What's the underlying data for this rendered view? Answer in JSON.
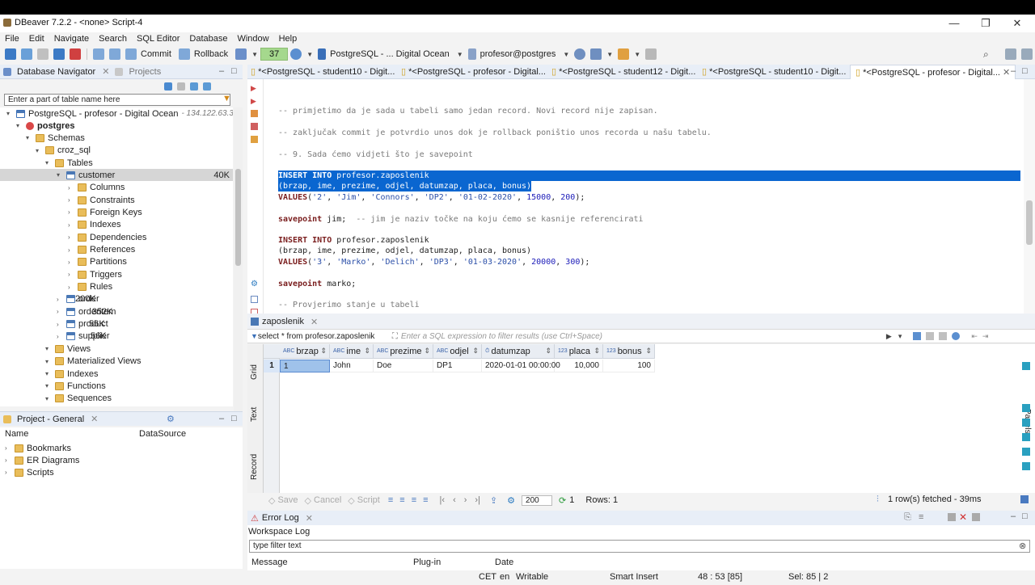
{
  "window": {
    "title": "DBeaver 7.2.2 - <none> Script-4",
    "minimize": "—",
    "restore": "❐",
    "close": "✕"
  },
  "menu": [
    "File",
    "Edit",
    "Navigate",
    "Search",
    "SQL Editor",
    "Database",
    "Window",
    "Help"
  ],
  "toolbar": {
    "commit_label": "Commit",
    "rollback_label": "Rollback",
    "counter": "37",
    "datasource": "PostgreSQL - ... Digital Ocean",
    "schema": "profesor@postgres"
  },
  "navigator": {
    "tab_db": "Database Navigator",
    "tab_projects": "Projects",
    "search_placeholder": "Enter a part of table name here",
    "connection": "PostgreSQL - profesor - Digital Ocean",
    "connection_host": "- 134.122.63.33:543",
    "tree": [
      {
        "label": "postgres",
        "level": 1,
        "icon": "db"
      },
      {
        "label": "Schemas",
        "level": 2,
        "icon": "folder"
      },
      {
        "label": "croz_sql",
        "level": 3,
        "icon": "schema"
      },
      {
        "label": "Tables",
        "level": 4,
        "icon": "folder"
      },
      {
        "label": "customer",
        "level": 5,
        "icon": "table",
        "size": "40K",
        "selected": true
      },
      {
        "label": "Columns",
        "level": 6,
        "icon": "folder"
      },
      {
        "label": "Constraints",
        "level": 6,
        "icon": "folder"
      },
      {
        "label": "Foreign Keys",
        "level": 6,
        "icon": "folder"
      },
      {
        "label": "Indexes",
        "level": 6,
        "icon": "folder"
      },
      {
        "label": "Dependencies",
        "level": 6,
        "icon": "folder"
      },
      {
        "label": "References",
        "level": 6,
        "icon": "folder"
      },
      {
        "label": "Partitions",
        "level": 6,
        "icon": "folder"
      },
      {
        "label": "Triggers",
        "level": 6,
        "icon": "folder"
      },
      {
        "label": "Rules",
        "level": 6,
        "icon": "folder"
      },
      {
        "label": "order",
        "level": 5,
        "icon": "table",
        "size": "200K"
      },
      {
        "label": "orderitem",
        "level": 5,
        "icon": "table",
        "size": "352K"
      },
      {
        "label": "product",
        "level": 5,
        "icon": "table",
        "size": "56K"
      },
      {
        "label": "supplier",
        "level": 5,
        "icon": "table",
        "size": "56K"
      },
      {
        "label": "Views",
        "level": 4,
        "icon": "folder"
      },
      {
        "label": "Materialized Views",
        "level": 4,
        "icon": "folder"
      },
      {
        "label": "Indexes",
        "level": 4,
        "icon": "folder"
      },
      {
        "label": "Functions",
        "level": 4,
        "icon": "folder"
      },
      {
        "label": "Sequences",
        "level": 4,
        "icon": "folder"
      }
    ]
  },
  "project": {
    "tab": "Project - General",
    "col_name": "Name",
    "col_ds": "DataSource",
    "items": [
      "Bookmarks",
      "ER Diagrams",
      "Scripts"
    ]
  },
  "editor_tabs": [
    "*<PostgreSQL - student10 - Digit...",
    "*<PostgreSQL - profesor - Digital...",
    "*<PostgreSQL - student12 - Digit...",
    "*<PostgreSQL - student10 - Digit...",
    "*<PostgreSQL - profesor - Digital..."
  ],
  "code": {
    "l1": "-- primjetimo da je sada u tabeli samo jedan record. Novi record nije zapisan.",
    "l2": "-- zaključak commit je potvrdio unos dok je rollback poništio unos recorda u našu tabelu.",
    "l3": "-- 9. Sada ćemo vidjeti što je savepoint",
    "insert_kw": "INSERT INTO",
    "insert_tbl": " profesor.zaposlenik",
    "cols": "(brzap, ime, prezime, odjel, datumzap, placa, bonus)",
    "values_kw": "VALUES",
    "v1_open": "(",
    "v1_s1": "'2'",
    "v1_s2": "'Jim'",
    "v1_s3": "'Connors'",
    "v1_s4": "'DP2'",
    "v1_s5": "'01-02-2020'",
    "v1_n1": "15000",
    "v1_n2": "200",
    "sep": ", ",
    "close": ");",
    "savepoint_kw": "savepoint",
    "sp1": " jim;",
    "sp1_cm": "  -- jim je naziv točke na koju ćemo se kasnije referencirati",
    "v2_s1": "'3'",
    "v2_s2": "'Marko'",
    "v2_s3": "'Delich'",
    "v2_s4": "'DP3'",
    "v2_s5": "'01-03-2020'",
    "v2_n1": "20000",
    "v2_n2": "300",
    "sp2": " marko;",
    "l_last": "-- Provjerimo stanje u tabeli"
  },
  "results": {
    "tab": "zaposlenik",
    "query": "select * from profesor.zaposlenik",
    "filter_placeholder": "Enter a SQL expression to filter results (use Ctrl+Space)",
    "side_grid": "Grid",
    "side_text": "Text",
    "side_record": "Record",
    "panels": "Panels",
    "columns": [
      "brzap",
      "ime",
      "prezime",
      "odjel",
      "datumzap",
      "placa",
      "bonus"
    ],
    "col_types": [
      "ABC",
      "ABC",
      "ABC",
      "ABC",
      "⏱",
      "123",
      "123"
    ],
    "rows": [
      {
        "num": "1",
        "cells": [
          "1",
          "John",
          "Doe",
          "DP1",
          "2020-01-01 00:00:00",
          "10,000",
          "100"
        ]
      }
    ],
    "save": "Save",
    "cancel": "Cancel",
    "script": "Script",
    "fetch_size": "200",
    "refresh_count": "1",
    "rows_label": "Rows: 1",
    "fetched": "1 row(s) fetched - 39ms"
  },
  "errorlog": {
    "tab": "Error Log",
    "workspace": "Workspace Log",
    "filter_placeholder": "type filter text",
    "col_message": "Message",
    "col_plugin": "Plug-in",
    "col_date": "Date"
  },
  "status": {
    "tz": "CET",
    "lang": "en",
    "mode": "Writable",
    "insert": "Smart Insert",
    "pos": "48 : 53 [85]",
    "sel": "Sel: 85 | 2"
  }
}
